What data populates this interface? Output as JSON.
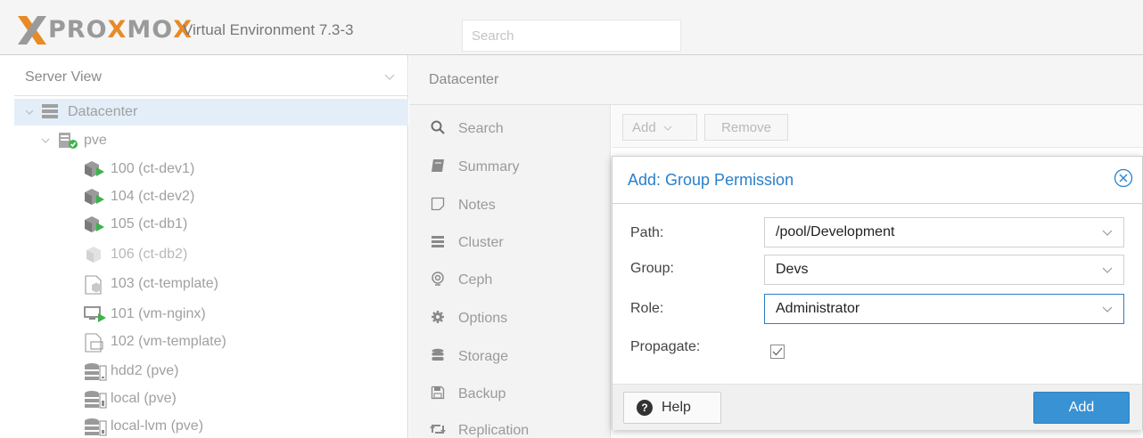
{
  "header": {
    "logo_parts": [
      "PRO",
      "X",
      "MO",
      "X"
    ],
    "version": "Virtual Environment 7.3-3",
    "search_placeholder": "Search"
  },
  "tree": {
    "view_label": "Server View",
    "items": [
      {
        "label": "Datacenter",
        "icon": "datacenter-icon"
      },
      {
        "label": "pve",
        "icon": "node-icon"
      },
      {
        "label": "100 (ct-dev1)",
        "icon": "running-container-icon"
      },
      {
        "label": "104 (ct-dev2)",
        "icon": "running-container-icon"
      },
      {
        "label": "105 (ct-db1)",
        "icon": "running-container-icon"
      },
      {
        "label": "106 (ct-db2)",
        "icon": "stopped-container-icon"
      },
      {
        "label": "103 (ct-template)",
        "icon": "container-template-icon"
      },
      {
        "label": "101 (vm-nginx)",
        "icon": "running-vm-icon"
      },
      {
        "label": "102 (vm-template)",
        "icon": "vm-template-icon"
      },
      {
        "label": "hdd2 (pve)",
        "icon": "storage-icon"
      },
      {
        "label": "local (pve)",
        "icon": "storage-icon"
      },
      {
        "label": "local-lvm (pve)",
        "icon": "storage-icon"
      }
    ]
  },
  "breadcrumb": "Datacenter",
  "nav": {
    "items": [
      {
        "label": "Search",
        "icon": "search-icon"
      },
      {
        "label": "Summary",
        "icon": "book-icon"
      },
      {
        "label": "Notes",
        "icon": "sticky-note-icon"
      },
      {
        "label": "Cluster",
        "icon": "server-icon"
      },
      {
        "label": "Ceph",
        "icon": "ceph-icon"
      },
      {
        "label": "Options",
        "icon": "gear-icon"
      },
      {
        "label": "Storage",
        "icon": "database-icon"
      },
      {
        "label": "Backup",
        "icon": "floppy-icon"
      },
      {
        "label": "Replication",
        "icon": "retweet-icon"
      }
    ]
  },
  "toolbar": {
    "add_label": "Add",
    "remove_label": "Remove"
  },
  "dialog": {
    "title": "Add: Group Permission",
    "path_label": "Path:",
    "path_value": "/pool/Development",
    "group_label": "Group:",
    "group_value": "Devs",
    "role_label": "Role:",
    "role_value": "Administrator",
    "propagate_label": "Propagate:",
    "propagate_checked": true,
    "help_label": "Help",
    "add_label": "Add"
  },
  "colors": {
    "accent": "#2a7fc9",
    "primary_button": "#3892d4",
    "logo_orange": "#e88a26",
    "running_green": "#3bb34a"
  }
}
